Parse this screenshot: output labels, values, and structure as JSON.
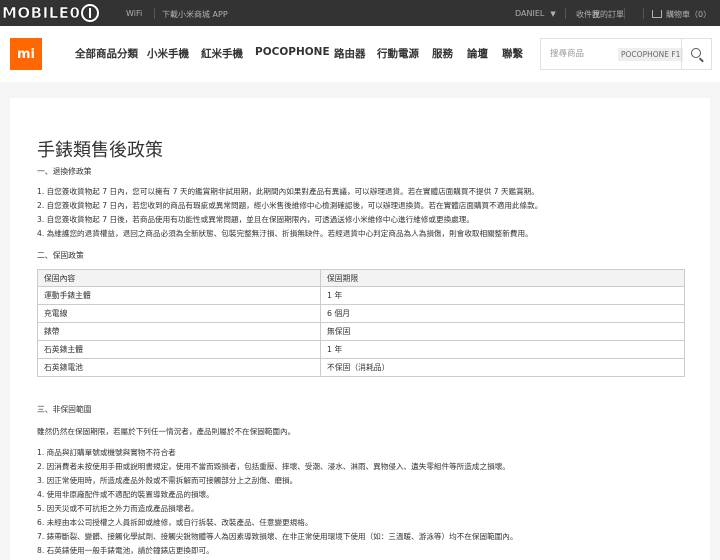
{
  "topbar": {
    "watermark_text": "MOBILE01",
    "items": [
      "WiFi",
      "下載小米商城 APP"
    ],
    "user": "DANIEL",
    "links": [
      "收件匣",
      "我的訂單"
    ],
    "cart": "購物車（0）"
  },
  "header": {
    "logo": "mi",
    "nav": [
      "全部商品分類",
      "小米手機",
      "紅米手機",
      "POCOPHONE",
      "路由器",
      "行動電源",
      "服務",
      "論壇",
      "聯繫"
    ],
    "search": {
      "placeholder": "搜尋商品",
      "hot": "POCOPHONE F1"
    },
    "search_icon": "search-icon",
    "accent": "#ff6700"
  },
  "content": {
    "title": "手錶類售後政策",
    "sec1": "一、退換修政策",
    "sec1_items": [
      "1. 自您簽收貨物起 7 日內，您可以擁有 7 天的鑑賞期非試用期，此期間內如果對產品有異議，可以辦理退貨。若在實體店面購買不提供 7 天鑑賞期。",
      "2. 自您簽收貨物起 7 日內，若您收到的商品有瑕疵或異常問題，經小米售後維修中心檢測確認後，可以辦理退換貨。若在實體店面購買不適用此條款。",
      "3. 自您簽收貨物起 7 日後，若商品使用有功能性或異常問題，並且在保固期限內，可透過送修小米維修中心進行維修或更換處理。",
      "4. 為維護您的退貨權益，退回之商品必須為全新狀態、包裝完整無汙損、折損無缺件。若經退貨中心判定商品為人為損傷，則會收取相關整新費用。"
    ],
    "sec2": "二、保固政策",
    "warranty_table": {
      "headers": [
        "保固內容",
        "保固期限"
      ],
      "rows": [
        [
          "運動手錶主體",
          "1 年"
        ],
        [
          "充電線",
          "6 個月"
        ],
        [
          "錶帶",
          "無保固"
        ],
        [
          "石英錶主體",
          "1 年"
        ],
        [
          "石英錶電池",
          "不保固（消耗品）"
        ]
      ]
    },
    "sec3": "三、非保固範圍",
    "sec3_intro": "雖然仍然在保固期限，若屬於下列任一情況者，產品則屬於不在保固範圍內。",
    "sec3_items": [
      "1. 商品與訂購單號或機號與實物不符合者",
      "2. 因消費者未按使用手冊或說明書規定，使用不當而毀損者，包括重壓、摔壞、受潮、浸水、淋雨、異物侵入、遺失零組件等所造成之損壞。",
      "3. 因正常使用時，所造成產品外殼或不需拆解而可接觸部分上之刮傷、磨損。",
      "4. 使用非原廠配件或不適配的裝置導致產品的損壞。",
      "5. 因天災或不可抗拒之外力而造成產品損壞者。",
      "6. 未經由本公司授權之人員拆卸或維修，或自行拆裝、改裝產品、任意變更規格。",
      "7. 錶帶斷裂、變髒、接觸化學試劑、接觸尖銳物體等人為因素導致損壞、在非正常使用環境下使用（如：三溫暖、游泳等）均不在保固範圍內。",
      "8. 石英錶使用一般手錶電池，請於鐘錶店更換即可。"
    ]
  }
}
